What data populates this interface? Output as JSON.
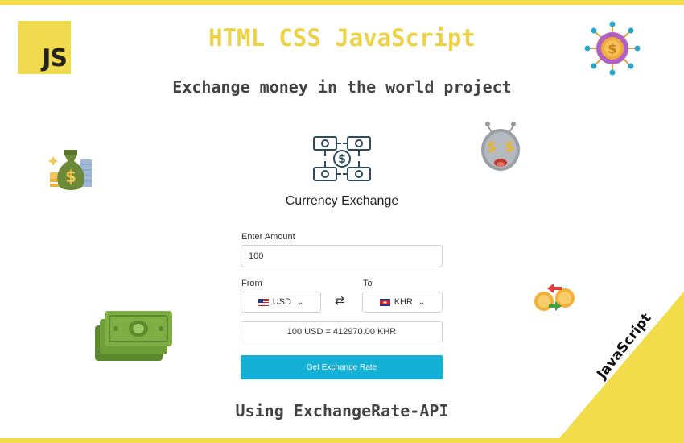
{
  "header": {
    "logo_text": "JS",
    "title": "HTML CSS JavaScript",
    "subtitle": "Exchange money in the world project"
  },
  "footer": {
    "text": "Using ExchangeRate-API"
  },
  "corner": {
    "text": "JavaScript"
  },
  "app": {
    "title": "Currency Exchange",
    "amount_label": "Enter Amount",
    "amount_value": "100",
    "from_label": "From",
    "to_label": "To",
    "from_currency": "USD",
    "to_currency": "KHR",
    "swap_symbol": "⇄",
    "result": "100 USD = 412970.00 KHR",
    "button_label": "Get Exchange Rate"
  },
  "decorations": {
    "icons": [
      "js-logo-icon",
      "crypto-network-icon",
      "money-bag-icon",
      "money-face-icon",
      "currency-exchange-icon",
      "banknotes-icon",
      "coin-swap-icon"
    ]
  },
  "colors": {
    "accent_yellow": "#f2dc4a",
    "button": "#14b0d6",
    "text_dark": "#444444",
    "app_icon": "#2e4a5e"
  }
}
